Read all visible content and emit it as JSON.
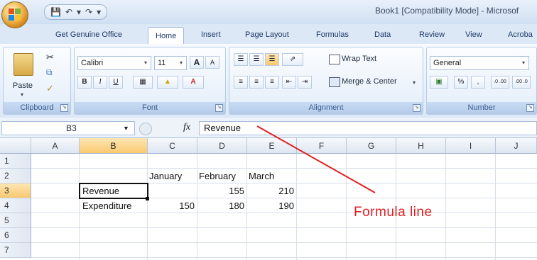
{
  "window": {
    "title": "Book1  [Compatibility Mode] - Microsof"
  },
  "quick_access": {
    "save_icon": "save-icon",
    "undo_icon": "undo-icon",
    "redo_icon": "redo-icon"
  },
  "tabs": [
    "Get Genuine Office",
    "Home",
    "Insert",
    "Page Layout",
    "Formulas",
    "Data",
    "Review",
    "View",
    "Acroba"
  ],
  "active_tab": "Home",
  "ribbon": {
    "clipboard": {
      "label": "Clipboard",
      "paste": "Paste"
    },
    "font": {
      "label": "Font",
      "family": "Calibri",
      "size": "11",
      "bold": "B",
      "italic": "I",
      "underline": "U",
      "grow": "A",
      "shrink": "A"
    },
    "alignment": {
      "label": "Alignment",
      "wrap_text": "Wrap Text",
      "merge_center": "Merge & Center"
    },
    "number": {
      "label": "Number",
      "format": "General",
      "percent": "%",
      "comma": ",",
      "inc_decimal": ".0 .00",
      "dec_decimal": ".00 .0"
    }
  },
  "formula_bar": {
    "name_box": "B3",
    "fx_label": "fx",
    "value": "Revenue"
  },
  "columns": [
    "A",
    "B",
    "C",
    "D",
    "E",
    "F",
    "G",
    "H",
    "I",
    "J"
  ],
  "selected_column": "B",
  "rows": [
    "1",
    "2",
    "3",
    "4",
    "5",
    "6",
    "7"
  ],
  "selected_row": "3",
  "cells": {
    "C2": "January",
    "D2": "February",
    "E2": "March",
    "B3": "Revenue",
    "D3": "155",
    "E3": "210",
    "B4": "Expenditure",
    "C4": "150",
    "D4": "180",
    "E4": "190"
  },
  "annotation": {
    "text": "Formula line",
    "color": "#e02020"
  },
  "colors": {
    "accent": "#f9c970",
    "ribbon": "#dbe8f7",
    "annotation": "#e02020"
  }
}
